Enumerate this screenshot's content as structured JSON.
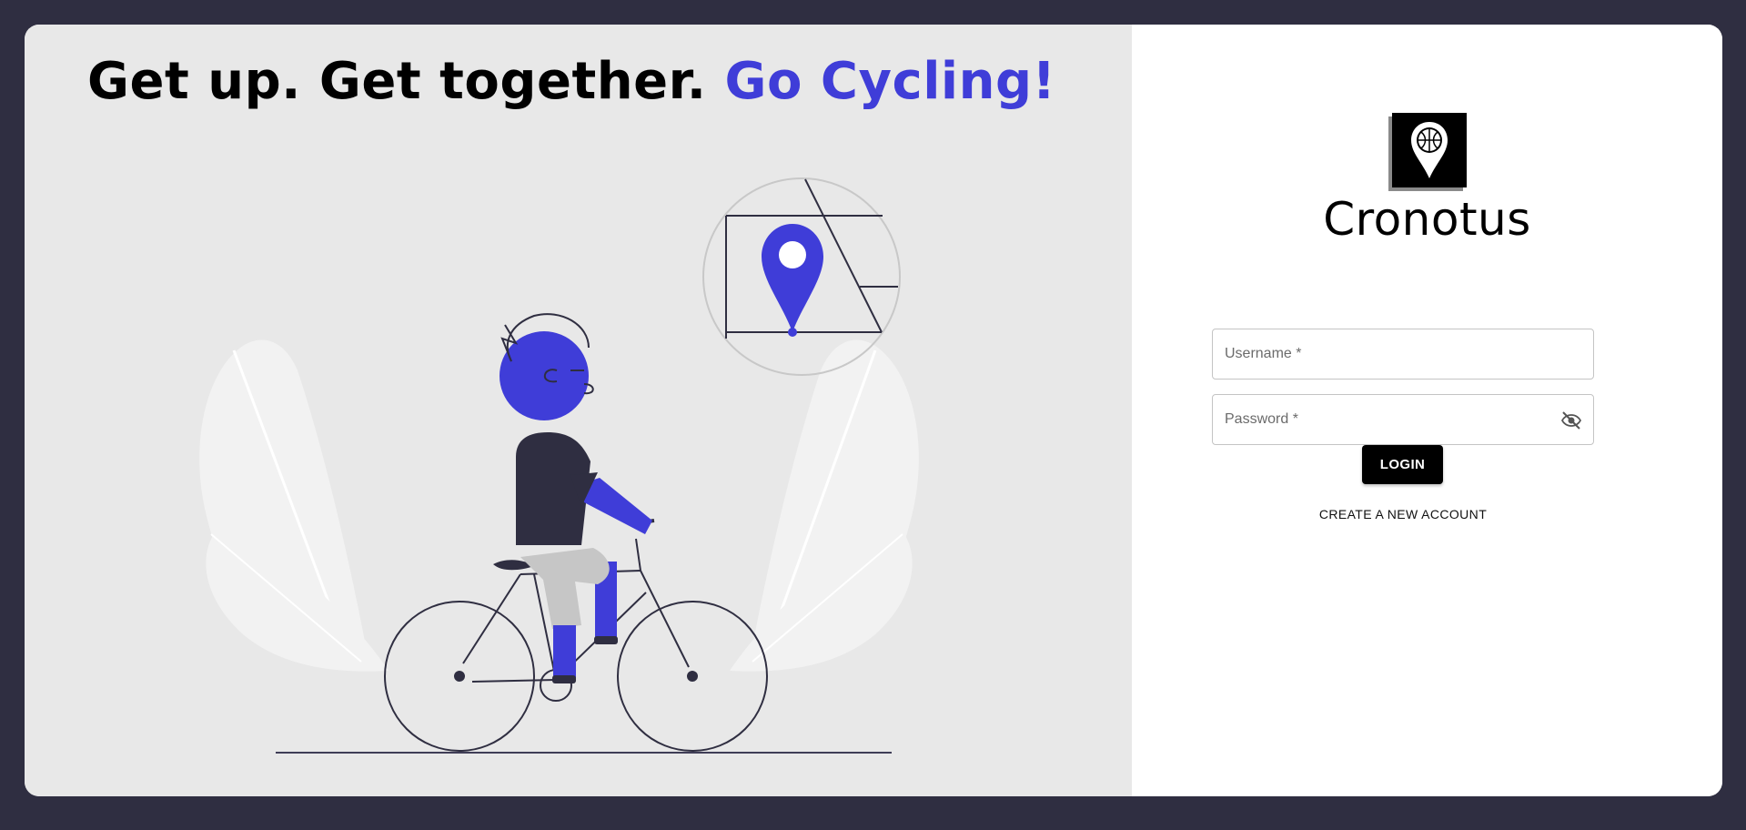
{
  "headline": {
    "part1": "Get up. Get together. ",
    "part2": "Go Cycling!"
  },
  "brand": {
    "name": "Cronotus",
    "logo_icon": "basketball-location-pin-icon"
  },
  "form": {
    "username_placeholder": "Username *",
    "password_placeholder": "Password *",
    "password_toggle_icon": "eye-off-icon",
    "login_label": "LOGIN",
    "create_account_label": "CREATE A NEW ACCOUNT"
  },
  "colors": {
    "page_background": "#2f2e41",
    "left_panel": "#e8e8e8",
    "accent": "#3f3dd8",
    "button": "#000000"
  },
  "illustration": {
    "subject": "person-riding-bicycle",
    "bubble_icon": "map-location-pin-icon"
  }
}
